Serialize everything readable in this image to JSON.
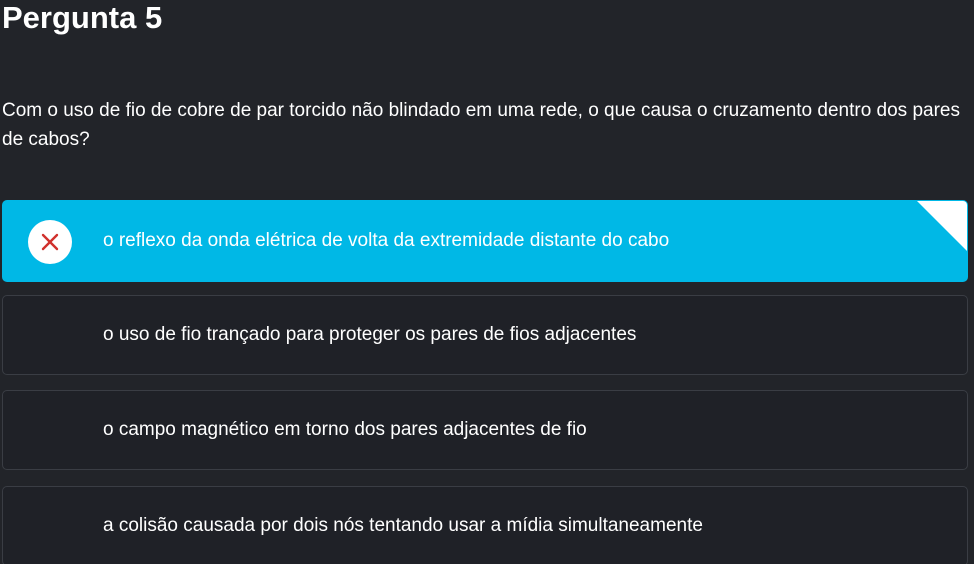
{
  "question": {
    "title": "Pergunta 5",
    "text": "Com o uso de fio de cobre de par torcido não blindado em uma rede, o que causa o cruzamento dentro dos pares de cabos?"
  },
  "options": [
    {
      "label": "o reflexo da onda elétrica de volta da extremidade distante do cabo",
      "selected": true,
      "status": "incorrect"
    },
    {
      "label": "o uso de fio trançado para proteger os pares de fios adjacentes",
      "selected": false
    },
    {
      "label": "o campo magnético em torno dos pares adjacentes de fio",
      "selected": false
    },
    {
      "label": "a colisão causada por dois nós tentando usar a mídia simultaneamente",
      "selected": false
    }
  ],
  "icons": {
    "incorrect_mark": "close-icon"
  },
  "colors": {
    "background": "#222429",
    "selected_option": "#00b8e6",
    "option_background": "#1f2127",
    "incorrect_mark": "#d0312d"
  }
}
